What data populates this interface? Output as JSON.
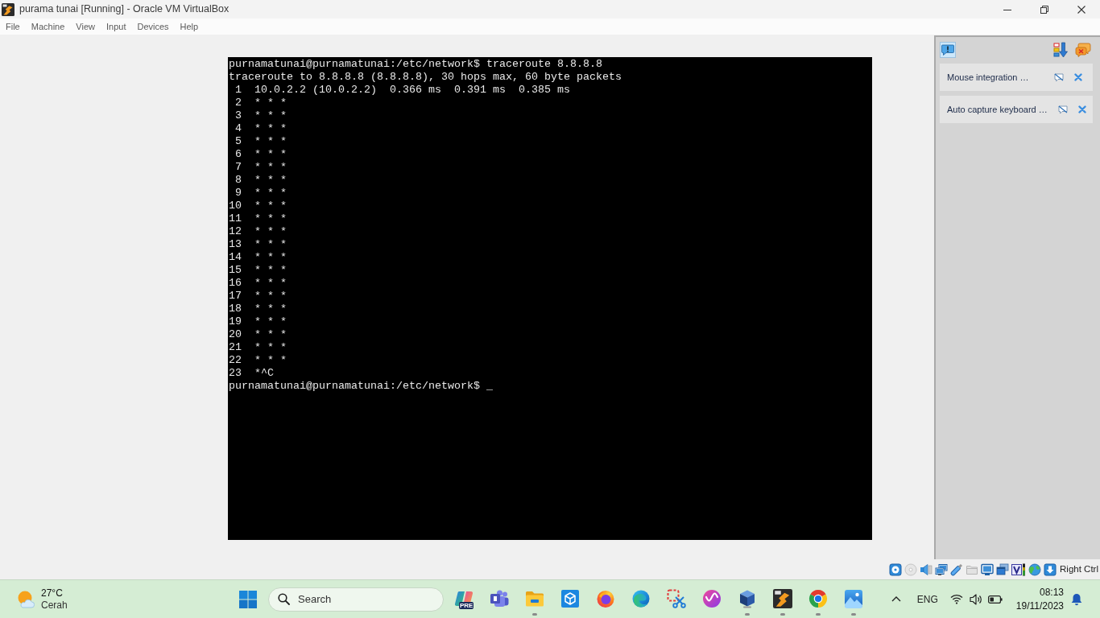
{
  "window": {
    "title": "purama tunai [Running] - Oracle VM VirtualBox"
  },
  "menu": [
    "File",
    "Machine",
    "View",
    "Input",
    "Devices",
    "Help"
  ],
  "terminal": {
    "lines": [
      "purnamatunai@purnamatunai:/etc/network$ traceroute 8.8.8.8",
      "traceroute to 8.8.8.8 (8.8.8.8), 30 hops max, 60 byte packets",
      " 1  10.0.2.2 (10.0.2.2)  0.366 ms  0.391 ms  0.385 ms",
      " 2  * * *",
      " 3  * * *",
      " 4  * * *",
      " 5  * * *",
      " 6  * * *",
      " 7  * * *",
      " 8  * * *",
      " 9  * * *",
      "10  * * *",
      "11  * * *",
      "12  * * *",
      "13  * * *",
      "14  * * *",
      "15  * * *",
      "16  * * *",
      "17  * * *",
      "18  * * *",
      "19  * * *",
      "20  * * *",
      "21  * * *",
      "22  * * *",
      "23  *^C",
      "purnamatunai@purnamatunai:/etc/network$ _"
    ]
  },
  "notification_panel": {
    "notifications": [
      {
        "text": "Mouse integration …"
      },
      {
        "text": "Auto capture keyboard …"
      }
    ]
  },
  "status_bar": {
    "host_key": "Right Ctrl"
  },
  "taskbar": {
    "weather": {
      "temperature": "27°C",
      "condition": "Cerah"
    },
    "search": {
      "placeholder": "Search"
    },
    "apps": [
      {
        "kind": "copilot",
        "badge": "PRE",
        "running": false
      },
      {
        "kind": "teams",
        "running": false
      },
      {
        "kind": "files",
        "running": true
      },
      {
        "kind": "cube-tile",
        "running": false
      },
      {
        "kind": "firefox",
        "running": false
      },
      {
        "kind": "edge",
        "running": false
      },
      {
        "kind": "snip",
        "running": false
      },
      {
        "kind": "wps",
        "running": false
      },
      {
        "kind": "virtualbox",
        "running": true
      },
      {
        "kind": "vm",
        "running": true
      },
      {
        "kind": "chrome",
        "running": true
      },
      {
        "kind": "photos",
        "running": true
      }
    ],
    "tray": {
      "language": "ENG",
      "time": "08:13",
      "date": "19/11/2023"
    }
  }
}
